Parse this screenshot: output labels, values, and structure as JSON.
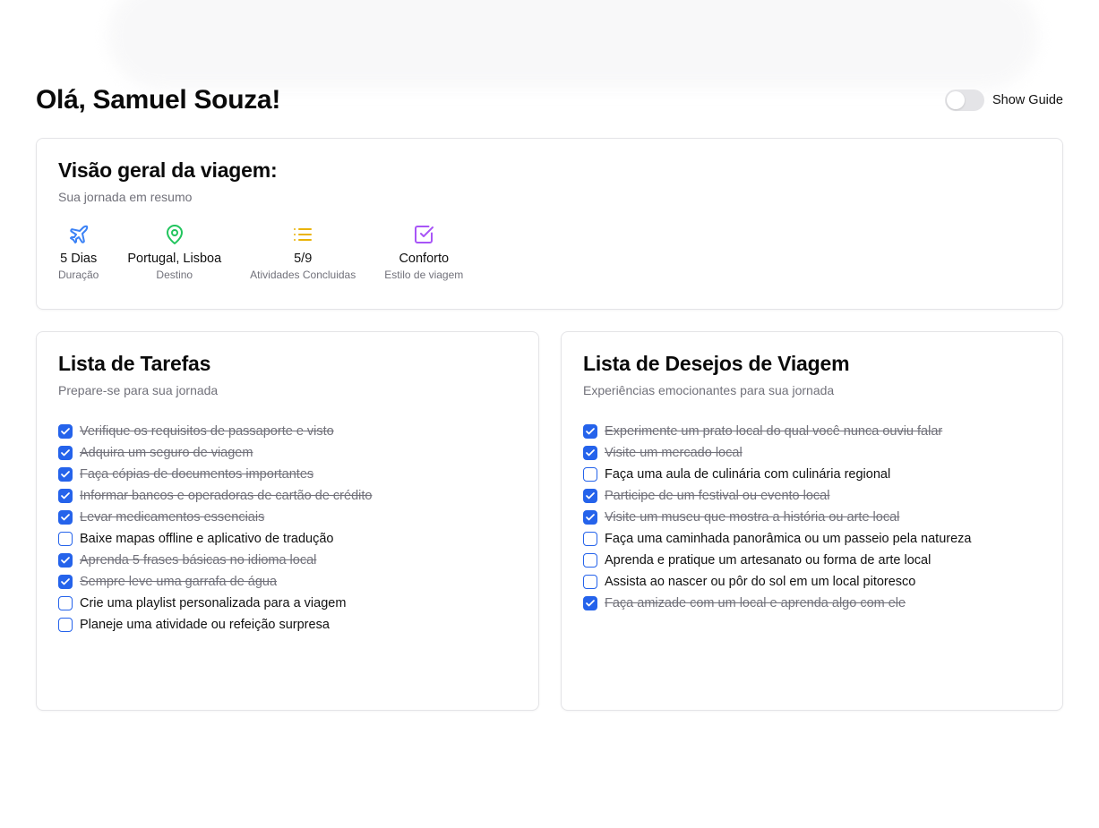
{
  "header": {
    "greeting": "Olá, Samuel Souza!",
    "guide_label": "Show Guide",
    "guide_enabled": false
  },
  "overview": {
    "title": "Visão geral da viagem:",
    "subtitle": "Sua jornada em resumo",
    "stats": [
      {
        "icon": "plane-icon",
        "color": "#3b82f6",
        "value": "5 Dias",
        "label": "Duração"
      },
      {
        "icon": "map-pin-icon",
        "color": "#22c55e",
        "value": "Portugal, Lisboa",
        "label": "Destino"
      },
      {
        "icon": "list-icon",
        "color": "#eab308",
        "value": "5/9",
        "label": "Atividades Concluidas"
      },
      {
        "icon": "check-square-icon",
        "color": "#a855f7",
        "value": "Conforto",
        "label": "Estilo de viagem"
      }
    ]
  },
  "todo": {
    "title": "Lista de Tarefas",
    "subtitle": "Prepare-se para sua jornada",
    "items": [
      {
        "text": "Verifique os requisitos de passaporte e visto",
        "checked": true
      },
      {
        "text": "Adquira um seguro de viagem",
        "checked": true
      },
      {
        "text": "Faça cópias de documentos importantes",
        "checked": true
      },
      {
        "text": "Informar bancos e operadoras de cartão de crédito",
        "checked": true
      },
      {
        "text": "Levar medicamentos essenciais",
        "checked": true
      },
      {
        "text": "Baixe mapas offline e aplicativo de tradução",
        "checked": false
      },
      {
        "text": "Aprenda 5 frases básicas no idioma local",
        "checked": true
      },
      {
        "text": "Sempre leve uma garrafa de água",
        "checked": true
      },
      {
        "text": "Crie uma playlist personalizada para a viagem",
        "checked": false
      },
      {
        "text": "Planeje uma atividade ou refeição surpresa",
        "checked": false
      }
    ]
  },
  "wishlist": {
    "title": "Lista de Desejos de Viagem",
    "subtitle": "Experiências emocionantes para sua jornada",
    "items": [
      {
        "text": "Experimente um prato local do qual você nunca ouviu falar",
        "checked": true
      },
      {
        "text": "Visite um mercado local",
        "checked": true
      },
      {
        "text": "Faça uma aula de culinária com culinária regional",
        "checked": false
      },
      {
        "text": "Participe de um festival ou evento local",
        "checked": true
      },
      {
        "text": "Visite um museu que mostra a história ou arte local",
        "checked": true
      },
      {
        "text": "Faça uma caminhada panorâmica ou um passeio pela natureza",
        "checked": false
      },
      {
        "text": "Aprenda e pratique um artesanato ou forma de arte local",
        "checked": false
      },
      {
        "text": "Assista ao nascer ou pôr do sol em um local pitoresco",
        "checked": false
      },
      {
        "text": "Faça amizade com um local e aprenda algo com ele",
        "checked": true
      }
    ]
  },
  "colors": {
    "accent": "#2563eb",
    "muted_text": "#71717a",
    "border": "#e4e4e7"
  }
}
